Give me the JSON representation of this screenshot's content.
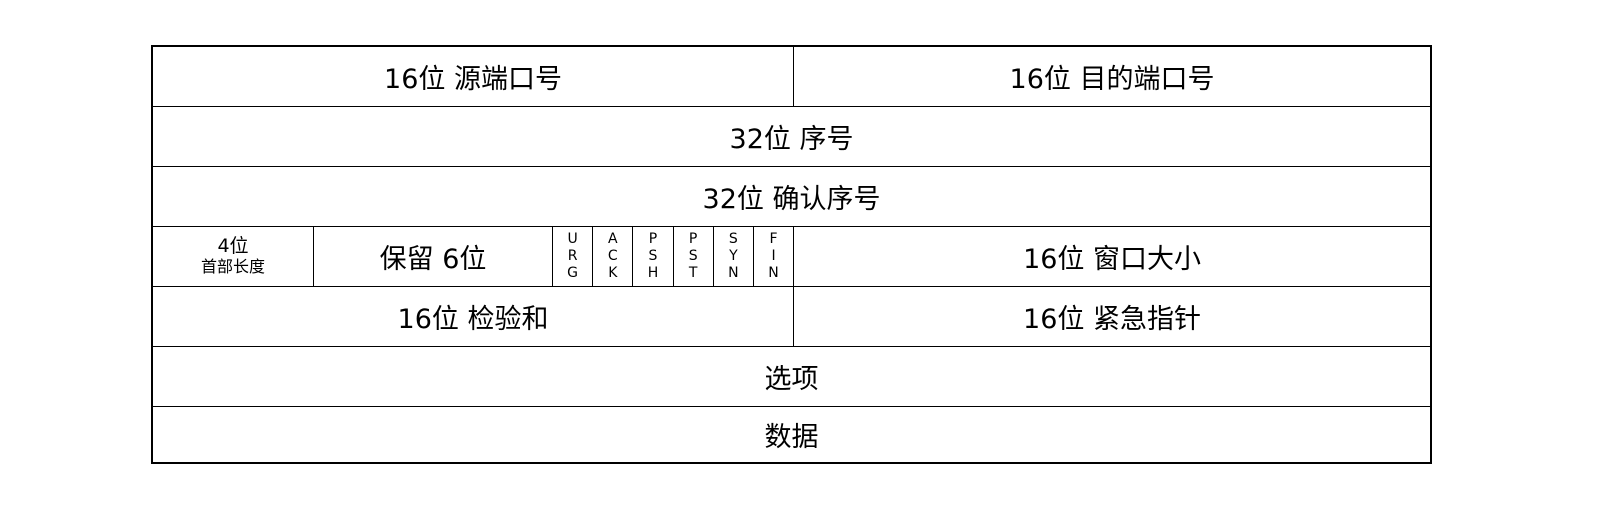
{
  "rows": {
    "src_port": "16位 源端口号",
    "dst_port": "16位 目的端口号",
    "seq": "32位 序号",
    "ack_seq": "32位 确认序号",
    "header_len_bits": "4位",
    "header_len_label": "首部长度",
    "reserved": "保留 6位",
    "flags": [
      [
        "U",
        "R",
        "G"
      ],
      [
        "A",
        "C",
        "K"
      ],
      [
        "P",
        "S",
        "H"
      ],
      [
        "P",
        "S",
        "T"
      ],
      [
        "S",
        "Y",
        "N"
      ],
      [
        "F",
        "I",
        "N"
      ]
    ],
    "window": "16位 窗口大小",
    "checksum": "16位 检验和",
    "urgent": "16位 紧急指针",
    "options": "选项",
    "data": "数据"
  }
}
